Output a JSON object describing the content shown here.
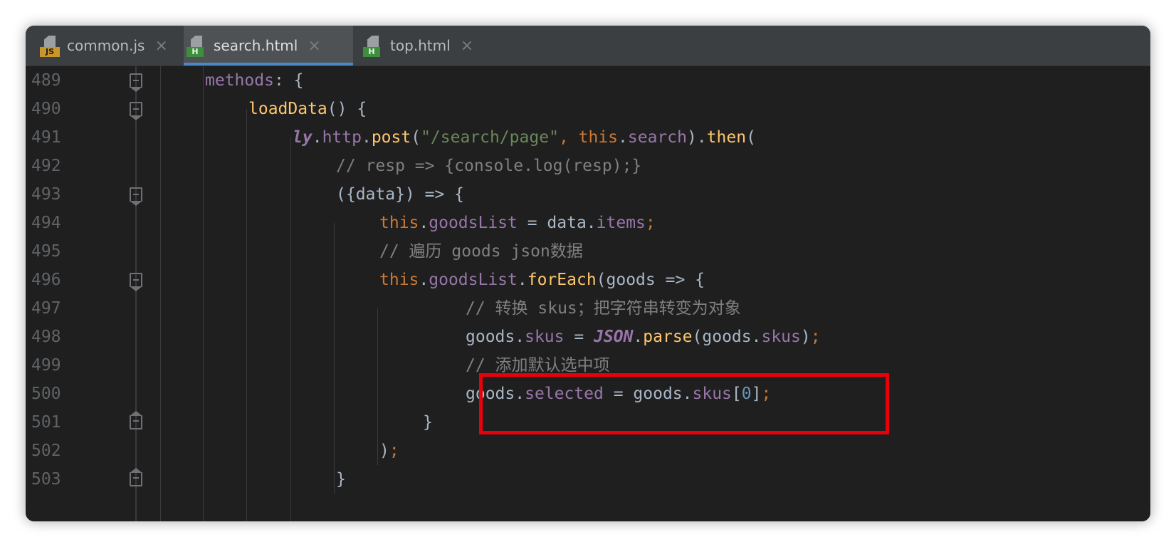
{
  "tabs": [
    {
      "label": "common.js",
      "icon": "js-file-icon",
      "active": false
    },
    {
      "label": "search.html",
      "icon": "html-file-icon",
      "active": true
    },
    {
      "label": "top.html",
      "icon": "html-file-icon",
      "active": false
    }
  ],
  "icon_badges": {
    "js": "JS",
    "html": "H"
  },
  "close_glyph": "×",
  "lines": [
    {
      "num": "489",
      "tokens": [
        [
          "t-prop",
          "methods"
        ],
        [
          "t-plain",
          ": {"
        ]
      ]
    },
    {
      "num": "490",
      "tokens": [
        [
          "t-fn",
          "loadData"
        ],
        [
          "t-plain",
          "() {"
        ]
      ]
    },
    {
      "num": "491",
      "tokens": [
        [
          "t-ly",
          "ly"
        ],
        [
          "t-plain",
          "."
        ],
        [
          "t-prop",
          "http"
        ],
        [
          "t-plain",
          "."
        ],
        [
          "t-fn",
          "post"
        ],
        [
          "t-plain",
          "("
        ],
        [
          "t-str",
          "\"/search/page\""
        ],
        [
          "t-kw",
          ", "
        ],
        [
          "t-kw",
          "this"
        ],
        [
          "t-plain",
          "."
        ],
        [
          "t-prop",
          "search"
        ],
        [
          "t-plain",
          ")."
        ],
        [
          "t-fn",
          "then"
        ],
        [
          "t-plain",
          "("
        ]
      ]
    },
    {
      "num": "492",
      "tokens": [
        [
          "t-cmt",
          "// resp => {console.log(resp);}"
        ]
      ]
    },
    {
      "num": "493",
      "tokens": [
        [
          "t-plain",
          "({data}) => {"
        ]
      ]
    },
    {
      "num": "494",
      "tokens": [
        [
          "t-kw",
          "this"
        ],
        [
          "t-plain",
          "."
        ],
        [
          "t-prop",
          "goodsList"
        ],
        [
          "t-plain",
          " = data."
        ],
        [
          "t-prop",
          "items"
        ],
        [
          "t-kw",
          ";"
        ]
      ]
    },
    {
      "num": "495",
      "tokens": [
        [
          "t-cmt",
          "// 遍历 goods json数据"
        ]
      ]
    },
    {
      "num": "496",
      "tokens": [
        [
          "t-kw",
          "this"
        ],
        [
          "t-plain",
          "."
        ],
        [
          "t-prop",
          "goodsList"
        ],
        [
          "t-plain",
          "."
        ],
        [
          "t-fn",
          "forEach"
        ],
        [
          "t-plain",
          "(goods => {"
        ]
      ]
    },
    {
      "num": "497",
      "tokens": [
        [
          "t-cmt",
          "// 转换 skus；把字符串转变为对象"
        ]
      ]
    },
    {
      "num": "498",
      "tokens": [
        [
          "t-plain",
          "goods."
        ],
        [
          "t-prop",
          "skus"
        ],
        [
          "t-plain",
          " = "
        ],
        [
          "t-obj",
          "JSON"
        ],
        [
          "t-plain",
          "."
        ],
        [
          "t-fn",
          "parse"
        ],
        [
          "t-plain",
          "(goods."
        ],
        [
          "t-prop",
          "skus"
        ],
        [
          "t-plain",
          ")"
        ],
        [
          "t-kw",
          ";"
        ]
      ]
    },
    {
      "num": "499",
      "tokens": [
        [
          "t-cmt",
          "// 添加默认选中项"
        ]
      ]
    },
    {
      "num": "500",
      "tokens": [
        [
          "t-plain",
          "goods."
        ],
        [
          "t-prop",
          "selected"
        ],
        [
          "t-plain",
          " = goods."
        ],
        [
          "t-prop",
          "skus"
        ],
        [
          "t-plain",
          "["
        ],
        [
          "t-num",
          "0"
        ],
        [
          "t-plain",
          "]"
        ],
        [
          "t-kw",
          ";"
        ]
      ]
    },
    {
      "num": "501",
      "tokens": [
        [
          "t-plain",
          "}"
        ]
      ]
    },
    {
      "num": "502",
      "tokens": [
        [
          "t-plain",
          ")"
        ],
        [
          "t-kw",
          ";"
        ]
      ]
    },
    {
      "num": "503",
      "tokens": [
        [
          "t-plain",
          "}"
        ]
      ]
    }
  ],
  "colors": {
    "keyword": "#cc7832",
    "function": "#ffc66d",
    "property": "#9876aa",
    "string": "#6a8759",
    "comment": "#808080",
    "number": "#6897bb",
    "plain": "#a9b7c6",
    "highlight_box": "#e8000a",
    "active_tab_underline": "#4a88c7"
  }
}
